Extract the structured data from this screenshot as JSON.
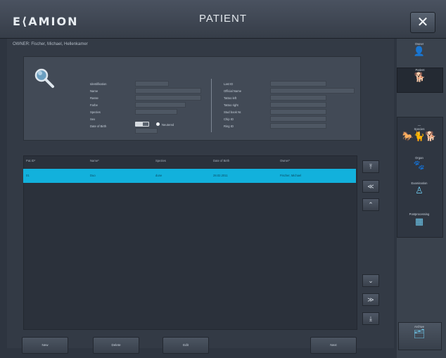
{
  "app": {
    "logo": "E⟨AMION",
    "title": "PATIENT",
    "close_glyph": "✕"
  },
  "breadcrumb": "OWNER: Fischer, Michael, Hellenkamer",
  "search": {
    "left_labels": [
      "Identifikation",
      "Name",
      "Rasse",
      "Farbe",
      "Spezies",
      "Sex",
      "Date of Birth"
    ],
    "right_labels": [
      "Last ID",
      "Official Name",
      "Tattoo left",
      "Tattoo right",
      "Stud book Nr.",
      "Chip ID",
      "Ring ID"
    ],
    "neutered_label": "Neutered"
  },
  "grid": {
    "columns": [
      "Pat.ID*",
      "Name*",
      "Spezies",
      "Date of Birth",
      "Owner*"
    ],
    "rows": [
      {
        "cells": [
          "01",
          "Duo",
          "dune",
          "28.02.2011",
          "Fischer, Michael"
        ]
      }
    ]
  },
  "scroll": {
    "top": "⤒",
    "page_up": "≪",
    "up": "⌃",
    "down": "⌄",
    "page_down": "≫",
    "bottom": "⤓"
  },
  "buttons": {
    "new": "New",
    "delete": "Delete",
    "edit": "Edit",
    "next": "Next"
  },
  "sidebar": {
    "owner": "Owner",
    "patient": "Patient",
    "species_head": "—",
    "species": "Species",
    "organ": "Organ",
    "examination": "Examination",
    "postprocessing": "Postprocessing",
    "archive": "Archive"
  },
  "colors": {
    "accent": "#12b1dc",
    "background": "#2e3540",
    "icon": "#6ec8ec"
  },
  "icons": {
    "search": "magnifier-icon",
    "owner": "person-icon",
    "patient": "dog-icon",
    "species": "animals-icon",
    "organ": "paw-icon",
    "examination": "body-icon",
    "postprocessing": "image-icon",
    "archive": "folders-icon"
  }
}
